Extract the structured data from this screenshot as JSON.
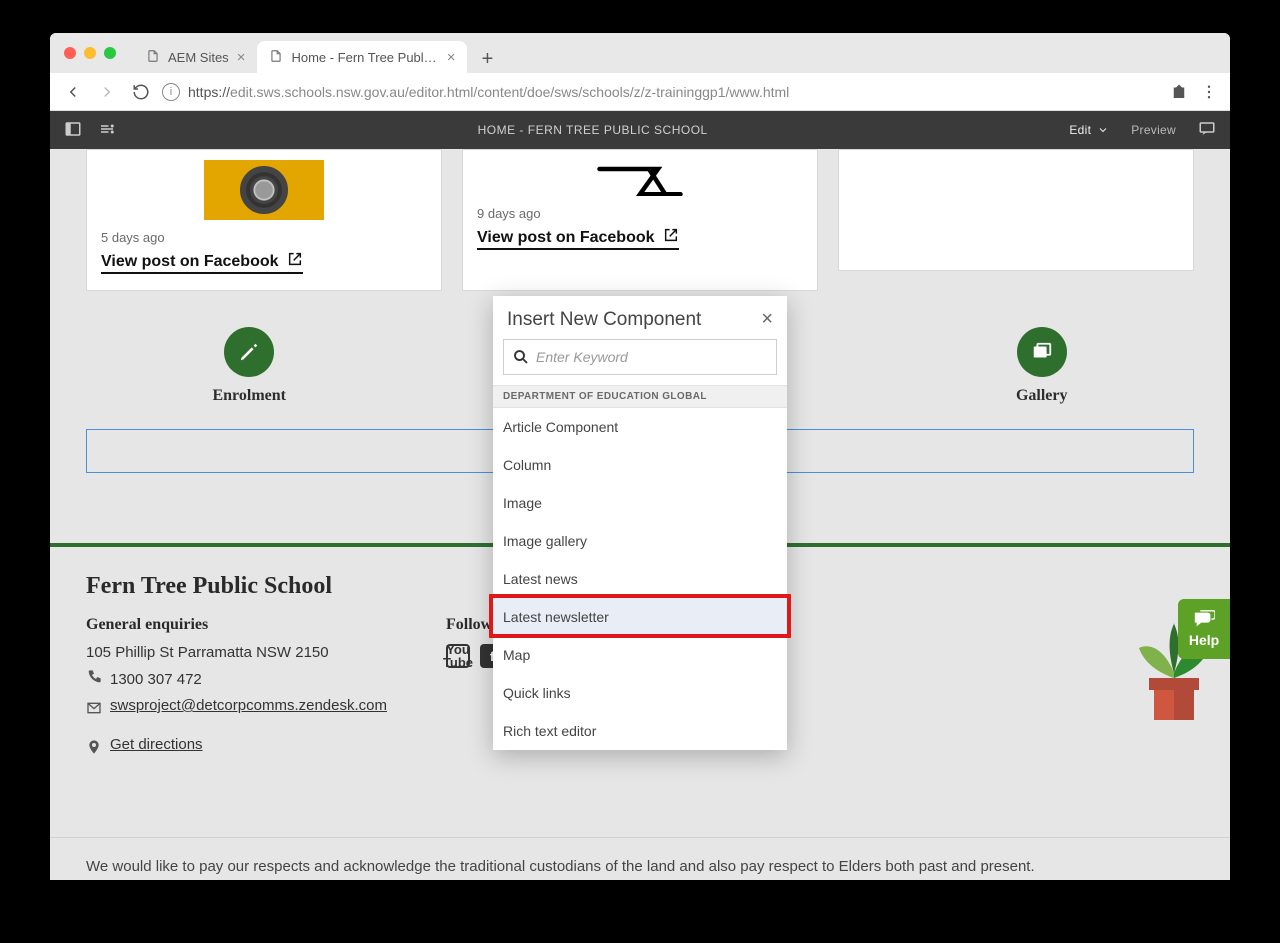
{
  "browser": {
    "tabs": [
      {
        "label": "AEM Sites",
        "active": false
      },
      {
        "label": "Home - Fern Tree Public Schoo",
        "active": true
      }
    ],
    "url_scheme": "https://",
    "url_host": "edit.sws.schools.nsw.gov.au",
    "url_path": "/editor.html/content/doe/sws/schools/z/z-traininggp1/www.html"
  },
  "aem": {
    "title": "HOME - FERN TREE PUBLIC SCHOOL",
    "mode": "Edit",
    "preview": "Preview"
  },
  "cards": [
    {
      "age": "5 days ago",
      "link_label": "View post on Facebook"
    },
    {
      "age": "9 days ago",
      "link_label": "View post on Facebook"
    }
  ],
  "quicklinks": {
    "items": [
      {
        "label": "Enrolment",
        "icon": "pencil"
      },
      {
        "label": "",
        "icon": ""
      },
      {
        "label": "",
        "icon": "news"
      },
      {
        "label": "Gallery",
        "icon": "picture"
      }
    ]
  },
  "footer": {
    "school": "Fern Tree Public School",
    "enquiries_heading": "General enquiries",
    "address": "105 Phillip St Parramatta NSW 2150",
    "phone": "1300 307 472",
    "email": "swsproject@detcorpcomms.zendesk.com",
    "directions": "Get directions",
    "follow_heading": "Follow us"
  },
  "acknowledge": "We would like to pay our respects and acknowledge the traditional custodians of the land and also pay respect to Elders both past and present.",
  "help_label": "Help",
  "modal": {
    "title": "Insert New Component",
    "search_placeholder": "Enter Keyword",
    "group": "DEPARTMENT OF EDUCATION GLOBAL",
    "items": [
      "Article Component",
      "Column",
      "Image",
      "Image gallery",
      "Latest news",
      "Latest newsletter",
      "Map",
      "Quick links",
      "Rich text editor"
    ],
    "highlight_index": 5
  }
}
